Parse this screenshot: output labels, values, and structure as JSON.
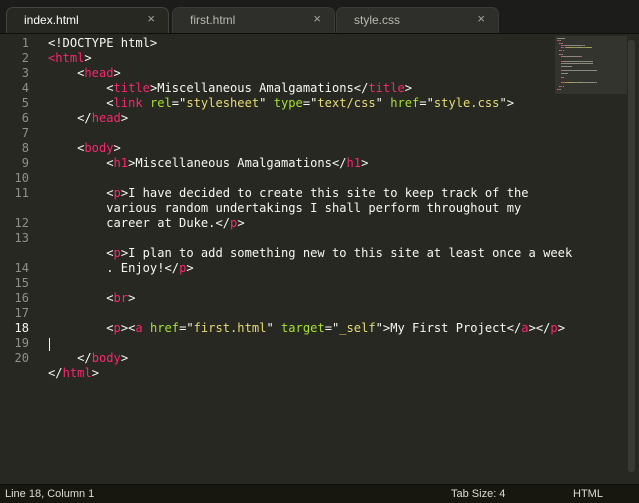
{
  "tabs": [
    {
      "label": "index.html",
      "close": "×",
      "active": true
    },
    {
      "label": "first.html",
      "close": "×",
      "active": false
    },
    {
      "label": "style.css",
      "close": "×",
      "active": false
    }
  ],
  "gutter": {
    "line_numbers": [
      "1",
      "2",
      "3",
      "4",
      "5",
      "6",
      "7",
      "8",
      "9",
      "10",
      "11",
      "",
      "12",
      "13",
      "",
      "14",
      "15",
      "16",
      "17",
      "18",
      "19",
      "20"
    ],
    "current_line": "18"
  },
  "code": {
    "lines": [
      [
        [
          "t",
          "<!DOCTYPE html>"
        ]
      ],
      [
        [
          "g",
          "<html"
        ],
        [
          "t",
          ">"
        ]
      ],
      [
        [
          "t",
          "    <"
        ],
        [
          "g",
          "head"
        ],
        [
          "t",
          ">"
        ]
      ],
      [
        [
          "t",
          "        <"
        ],
        [
          "g",
          "title"
        ],
        [
          "t",
          ">Miscellaneous Amalgamations</"
        ],
        [
          "g",
          "title"
        ],
        [
          "t",
          ">"
        ]
      ],
      [
        [
          "t",
          "        <"
        ],
        [
          "g",
          "link"
        ],
        [
          "t",
          " "
        ],
        [
          "a",
          "rel"
        ],
        [
          "t",
          "=\""
        ],
        [
          "s",
          "stylesheet"
        ],
        [
          "t",
          "\" "
        ],
        [
          "a",
          "type"
        ],
        [
          "t",
          "=\""
        ],
        [
          "s",
          "text/css"
        ],
        [
          "t",
          "\" "
        ],
        [
          "a",
          "href"
        ],
        [
          "t",
          "=\""
        ],
        [
          "s",
          "style.css"
        ],
        [
          "t",
          "\">"
        ]
      ],
      [
        [
          "t",
          "    </"
        ],
        [
          "g",
          "head"
        ],
        [
          "t",
          ">"
        ]
      ],
      [],
      [
        [
          "t",
          "    <"
        ],
        [
          "g",
          "body"
        ],
        [
          "t",
          ">"
        ]
      ],
      [
        [
          "t",
          "        <"
        ],
        [
          "g",
          "h1"
        ],
        [
          "t",
          ">Miscellaneous Amalgamations</"
        ],
        [
          "g",
          "h1"
        ],
        [
          "t",
          ">"
        ]
      ],
      [],
      [
        [
          "t",
          "        <"
        ],
        [
          "g",
          "p"
        ],
        [
          "t",
          ">I have decided to create this site to keep track of the"
        ]
      ],
      [
        [
          "t",
          "        various random undertakings I shall perform throughout my"
        ]
      ],
      [
        [
          "t",
          "        career at Duke.</"
        ],
        [
          "g",
          "p"
        ],
        [
          "t",
          ">"
        ]
      ],
      [],
      [
        [
          "t",
          "        <"
        ],
        [
          "g",
          "p"
        ],
        [
          "t",
          ">I plan to add something new to this site at least once a week"
        ]
      ],
      [
        [
          "t",
          "        . Enjoy!</"
        ],
        [
          "g",
          "p"
        ],
        [
          "t",
          ">"
        ]
      ],
      [],
      [
        [
          "t",
          "        <"
        ],
        [
          "g",
          "br"
        ],
        [
          "t",
          ">"
        ]
      ],
      [],
      [
        [
          "t",
          "        <"
        ],
        [
          "g",
          "p"
        ],
        [
          "t",
          "><"
        ],
        [
          "g",
          "a"
        ],
        [
          "t",
          " "
        ],
        [
          "a",
          "href"
        ],
        [
          "t",
          "=\""
        ],
        [
          "s",
          "first.html"
        ],
        [
          "t",
          "\" "
        ],
        [
          "a",
          "target"
        ],
        [
          "t",
          "=\""
        ],
        [
          "s",
          "_self"
        ],
        [
          "t",
          "\">My First Project</"
        ],
        [
          "g",
          "a"
        ],
        [
          "t",
          "></"
        ],
        [
          "g",
          "p"
        ],
        [
          "t",
          ">"
        ]
      ],
      [],
      [
        [
          "t",
          "    </"
        ],
        [
          "g",
          "body"
        ],
        [
          "t",
          ">"
        ]
      ],
      [
        [
          "t",
          "</"
        ],
        [
          "g",
          "html"
        ],
        [
          "t",
          ">"
        ]
      ]
    ]
  },
  "status": {
    "position": "Line 18, Column 1",
    "tab_size": "Tab Size: 4",
    "syntax": "HTML"
  },
  "colors": {
    "background": "#272822",
    "tag": "#f92672",
    "attribute": "#a6e22e",
    "string": "#e6db74",
    "text": "#f8f8f2"
  }
}
